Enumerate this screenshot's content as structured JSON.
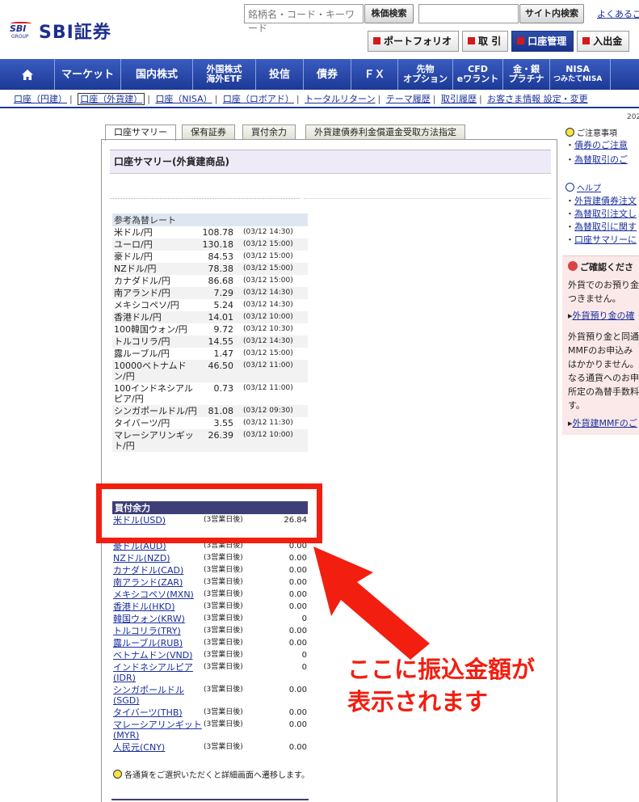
{
  "brand": {
    "logo_small": "SBI",
    "logo_group": "GROUP",
    "name": "SBI証券"
  },
  "header": {
    "search_placeholder": "銘柄名・コード・キーワード",
    "stock_search": "株価検索",
    "site_search": "サイト内検索",
    "faq": "よくあるご",
    "buttons": [
      {
        "label": "ポートフォリオ"
      },
      {
        "label": "取 引"
      },
      {
        "label": "口座管理",
        "active": true
      },
      {
        "label": "入出金"
      }
    ]
  },
  "nav": [
    {
      "label": ""
    },
    {
      "label": "マーケット"
    },
    {
      "label": "国内株式"
    },
    {
      "l1": "外国株式",
      "l2": "海外ETF"
    },
    {
      "label": "投信"
    },
    {
      "label": "債券"
    },
    {
      "label": "ＦＸ"
    },
    {
      "l1": "先物",
      "l2": "オプション"
    },
    {
      "l1": "CFD",
      "l2": "eワラント"
    },
    {
      "l1": "金・銀",
      "l2": "プラチナ"
    },
    {
      "l1": "NISA",
      "l2": "つみたてNISA"
    }
  ],
  "subnav": [
    "口座（円建）",
    "口座（外貨建）",
    "口座（NISA）",
    "口座（ロボアド）",
    "トータルリターン",
    "テーマ履歴",
    "取引履歴",
    "お客さま情報 設定・変更"
  ],
  "date_fragment": "202",
  "tabs": [
    "口座サマリー",
    "保有証券",
    "買付余力",
    "外貨建債券利金償還金受取方法指定"
  ],
  "panel_title": "口座サマリー(外貨建商品)",
  "fx_rates": {
    "header": "参考為替レート",
    "rows": [
      {
        "name": "米ドル/円",
        "rate": "108.78",
        "time": "(03/12 14:30)"
      },
      {
        "name": "ユーロ/円",
        "rate": "130.18",
        "time": "(03/12 15:00)"
      },
      {
        "name": "豪ドル/円",
        "rate": "84.53",
        "time": "(03/12 15:00)"
      },
      {
        "name": "NZドル/円",
        "rate": "78.38",
        "time": "(03/12 15:00)"
      },
      {
        "name": "カナダドル/円",
        "rate": "86.68",
        "time": "(03/12 15:00)"
      },
      {
        "name": "南アランド/円",
        "rate": "7.29",
        "time": "(03/12 14:30)"
      },
      {
        "name": "メキシコペソ/円",
        "rate": "5.24",
        "time": "(03/12 14:30)"
      },
      {
        "name": "香港ドル/円",
        "rate": "14.01",
        "time": "(03/12 10:00)"
      },
      {
        "name": "100韓国ウォン/円",
        "rate": "9.72",
        "time": "(03/12 10:30)"
      },
      {
        "name": "トルコリラ/円",
        "rate": "14.55",
        "time": "(03/12 14:30)"
      },
      {
        "name": "露ルーブル/円",
        "rate": "1.47",
        "time": "(03/12 15:00)"
      },
      {
        "name": "10000ベトナムドン/円",
        "rate": "46.50",
        "time": "(03/12 11:00)"
      },
      {
        "name": "100インドネシアルピア/円",
        "rate": "0.73",
        "time": "(03/12 11:00)"
      },
      {
        "name": "シンガポールドル/円",
        "rate": "81.08",
        "time": "(03/12 09:30)"
      },
      {
        "name": "タイバーツ/円",
        "rate": "3.55",
        "time": "(03/12 11:30)"
      },
      {
        "name": "マレーシアリンギット/円",
        "rate": "26.39",
        "time": "(03/12 10:00)"
      }
    ]
  },
  "buying_power": {
    "header": "買付余力",
    "rows": [
      {
        "name": "米ドル(USD)",
        "days": "(3営業日後)",
        "amount": "26.84"
      },
      {
        "name": "",
        "days": "",
        "amount": ""
      },
      {
        "name": "豪ドル(AUD)",
        "days": "(3営業日後)",
        "amount": "0.00"
      },
      {
        "name": "NZドル(NZD)",
        "days": "(3営業日後)",
        "amount": "0.00"
      },
      {
        "name": "カナダドル(CAD)",
        "days": "(3営業日後)",
        "amount": "0.00"
      },
      {
        "name": "南アランド(ZAR)",
        "days": "(3営業日後)",
        "amount": "0.00"
      },
      {
        "name": "メキシコペソ(MXN)",
        "days": "(3営業日後)",
        "amount": "0.00"
      },
      {
        "name": "香港ドル(HKD)",
        "days": "(3営業日後)",
        "amount": "0.00"
      },
      {
        "name": "韓国ウォン(KRW)",
        "days": "(3営業日後)",
        "amount": "0"
      },
      {
        "name": "トルコリラ(TRY)",
        "days": "(3営業日後)",
        "amount": "0.00"
      },
      {
        "name": "露ルーブル(RUB)",
        "days": "(3営業日後)",
        "amount": "0.00"
      },
      {
        "name": "ベトナムドン(VND)",
        "days": "(3営業日後)",
        "amount": "0"
      },
      {
        "name": "インドネシアルピア(IDR)",
        "days": "(3営業日後)",
        "amount": "0"
      },
      {
        "name": "シンガポールドル(SGD)",
        "days": "(3営業日後)",
        "amount": "0.00"
      },
      {
        "name": "タイバーツ(THB)",
        "days": "(3営業日後)",
        "amount": "0.00"
      },
      {
        "name": "マレーシアリンギット(MYR)",
        "days": "(3営業日後)",
        "amount": "0.00"
      },
      {
        "name": "人民元(CNY)",
        "days": "(3営業日後)",
        "amount": "0.00"
      }
    ],
    "note": "各通貨をご選択いただくと詳細画面へ遷移します。"
  },
  "sidebar": {
    "notice_title": "ご注意事項",
    "notice_links": [
      "債券のご注意",
      "為替取引のご"
    ],
    "help_title": "ヘルプ",
    "help_links": [
      "外貨建債券注文",
      "為替取引注文し",
      "為替取引に関す",
      "口座サマリーに"
    ],
    "confirm_title": "ご確認くださ",
    "confirm_p1": [
      "外貨でのお預り金",
      "つきません。"
    ],
    "confirm_link1": "外貨預り金の確",
    "confirm_p2": [
      "外貨預り金と同通",
      "MMFのお申込み",
      "はかかりません。",
      "なる通貨へのお申",
      "所定の為替手数料",
      "す。"
    ],
    "confirm_link2": "外貨建MMFのご"
  },
  "annotation": {
    "callout": [
      "ここに振込金額が",
      "表示されます"
    ],
    "color": "#f21e10"
  }
}
